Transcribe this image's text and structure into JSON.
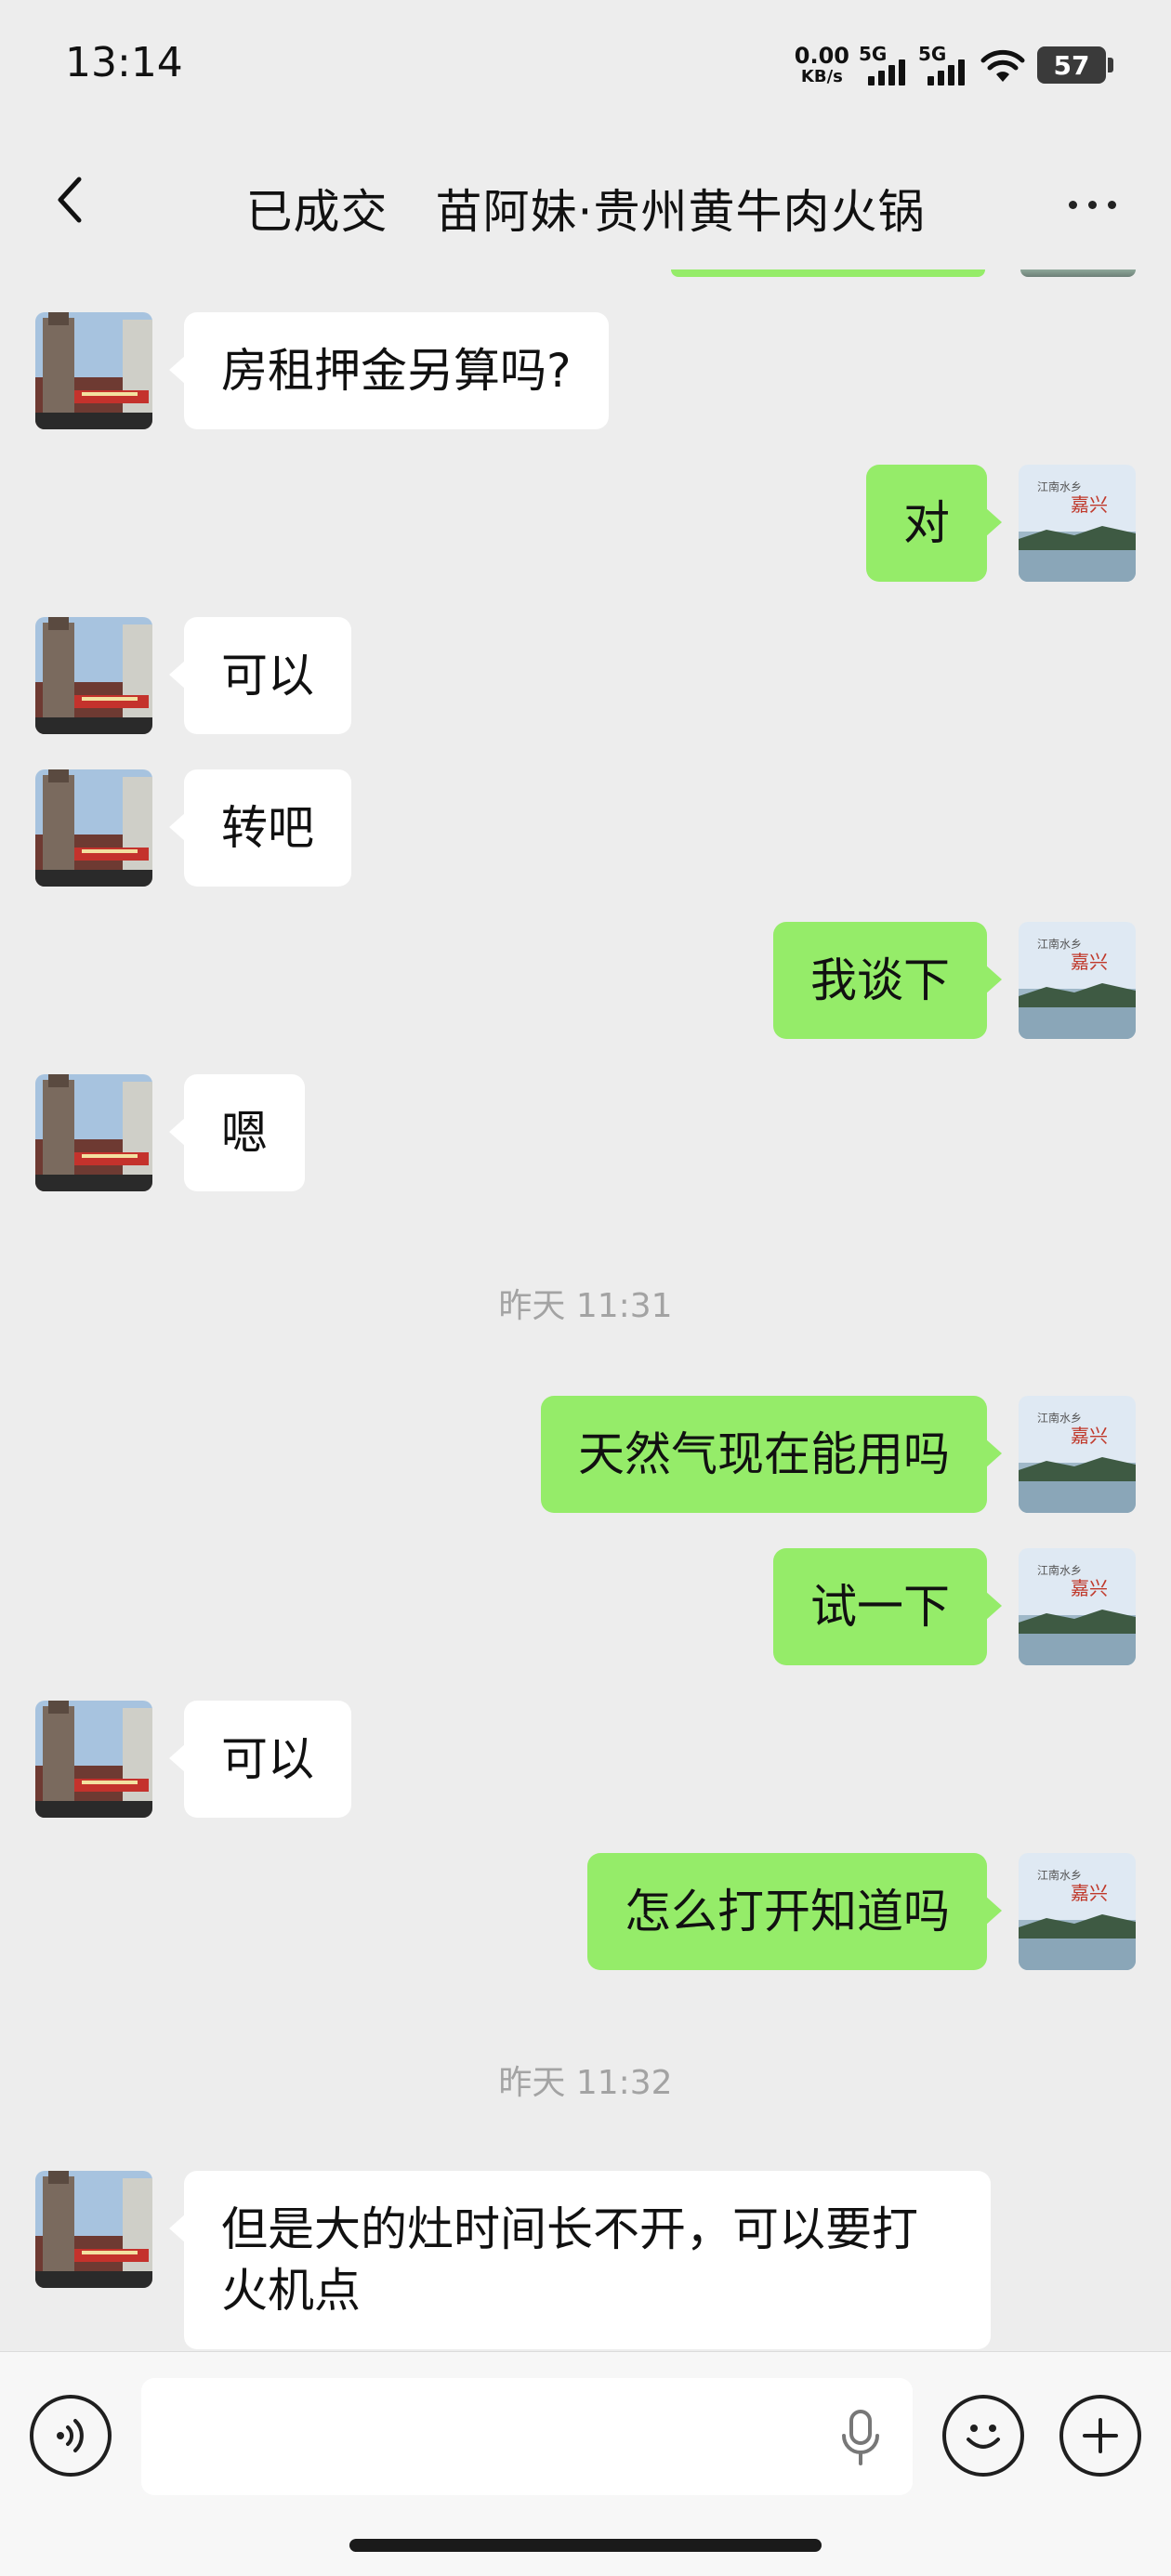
{
  "status_bar": {
    "time": "13:14",
    "net_speed_value": "0.00",
    "net_speed_unit": "KB/s",
    "sim1_label": "5G",
    "sim2_label": "5G",
    "battery_level": "57"
  },
  "header": {
    "title": "已成交　苗阿妹·贵州黄牛肉火锅"
  },
  "messages": [
    {
      "side": "in",
      "text": "房租押金另算吗?"
    },
    {
      "side": "out",
      "text": "对"
    },
    {
      "side": "in",
      "text": "可以"
    },
    {
      "side": "in",
      "text": "转吧"
    },
    {
      "side": "out",
      "text": "我谈下"
    },
    {
      "side": "in",
      "text": "嗯"
    },
    {
      "timestamp": "昨天 11:31"
    },
    {
      "side": "out",
      "text": "天然气现在能用吗"
    },
    {
      "side": "out",
      "text": "试一下"
    },
    {
      "side": "in",
      "text": "可以"
    },
    {
      "side": "out",
      "text": "怎么打开知道吗"
    },
    {
      "timestamp": "昨天 11:32"
    },
    {
      "side": "in",
      "text": "但是大的灶时间长不开，可以要打火机点"
    }
  ],
  "input": {
    "placeholder": "",
    "value": ""
  },
  "icons": {
    "back": "chevron-left-icon",
    "more": "more-dots-icon",
    "voice": "voice-icon",
    "mic": "mic-icon",
    "emoji": "emoji-icon",
    "plus": "plus-icon"
  },
  "colors": {
    "background": "#ededed",
    "outgoing_bubble": "#95ec69",
    "incoming_bubble": "#ffffff",
    "timestamp": "#a3a3a3"
  }
}
